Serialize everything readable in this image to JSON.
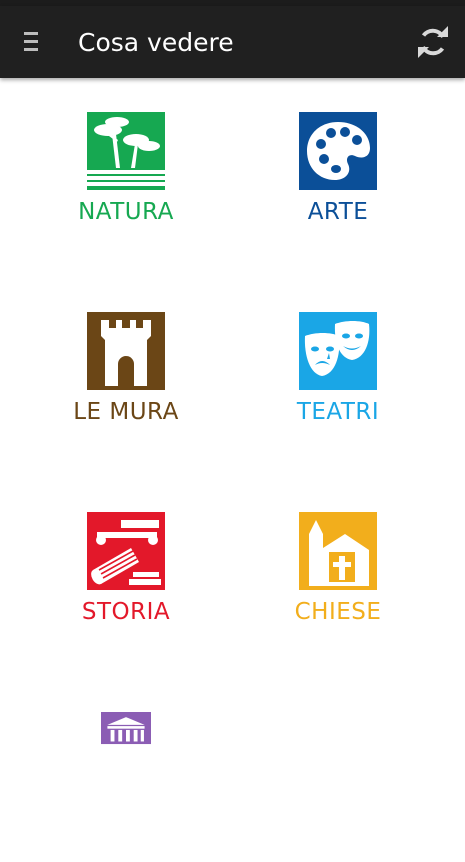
{
  "header": {
    "title": "Cosa vedere",
    "menu_icon": "drawer-menu-icon",
    "refresh_icon": "refresh-icon"
  },
  "categories": [
    {
      "label": "NATURA",
      "color": "#16a851",
      "icon": "pine-trees-icon"
    },
    {
      "label": "ARTE",
      "color": "#0b4f98",
      "icon": "palette-icon"
    },
    {
      "label": "LE MURA",
      "color": "#6b4616",
      "icon": "castle-tower-icon"
    },
    {
      "label": "TEATRI",
      "color": "#1aa6e6",
      "icon": "theatre-masks-icon"
    },
    {
      "label": "STORIA",
      "color": "#e3182a",
      "icon": "column-ruins-icon"
    },
    {
      "label": "CHIESE",
      "color": "#f2ae1c",
      "icon": "church-icon"
    },
    {
      "label": "",
      "color": "#8b5db4",
      "icon": "museum-icon"
    }
  ]
}
